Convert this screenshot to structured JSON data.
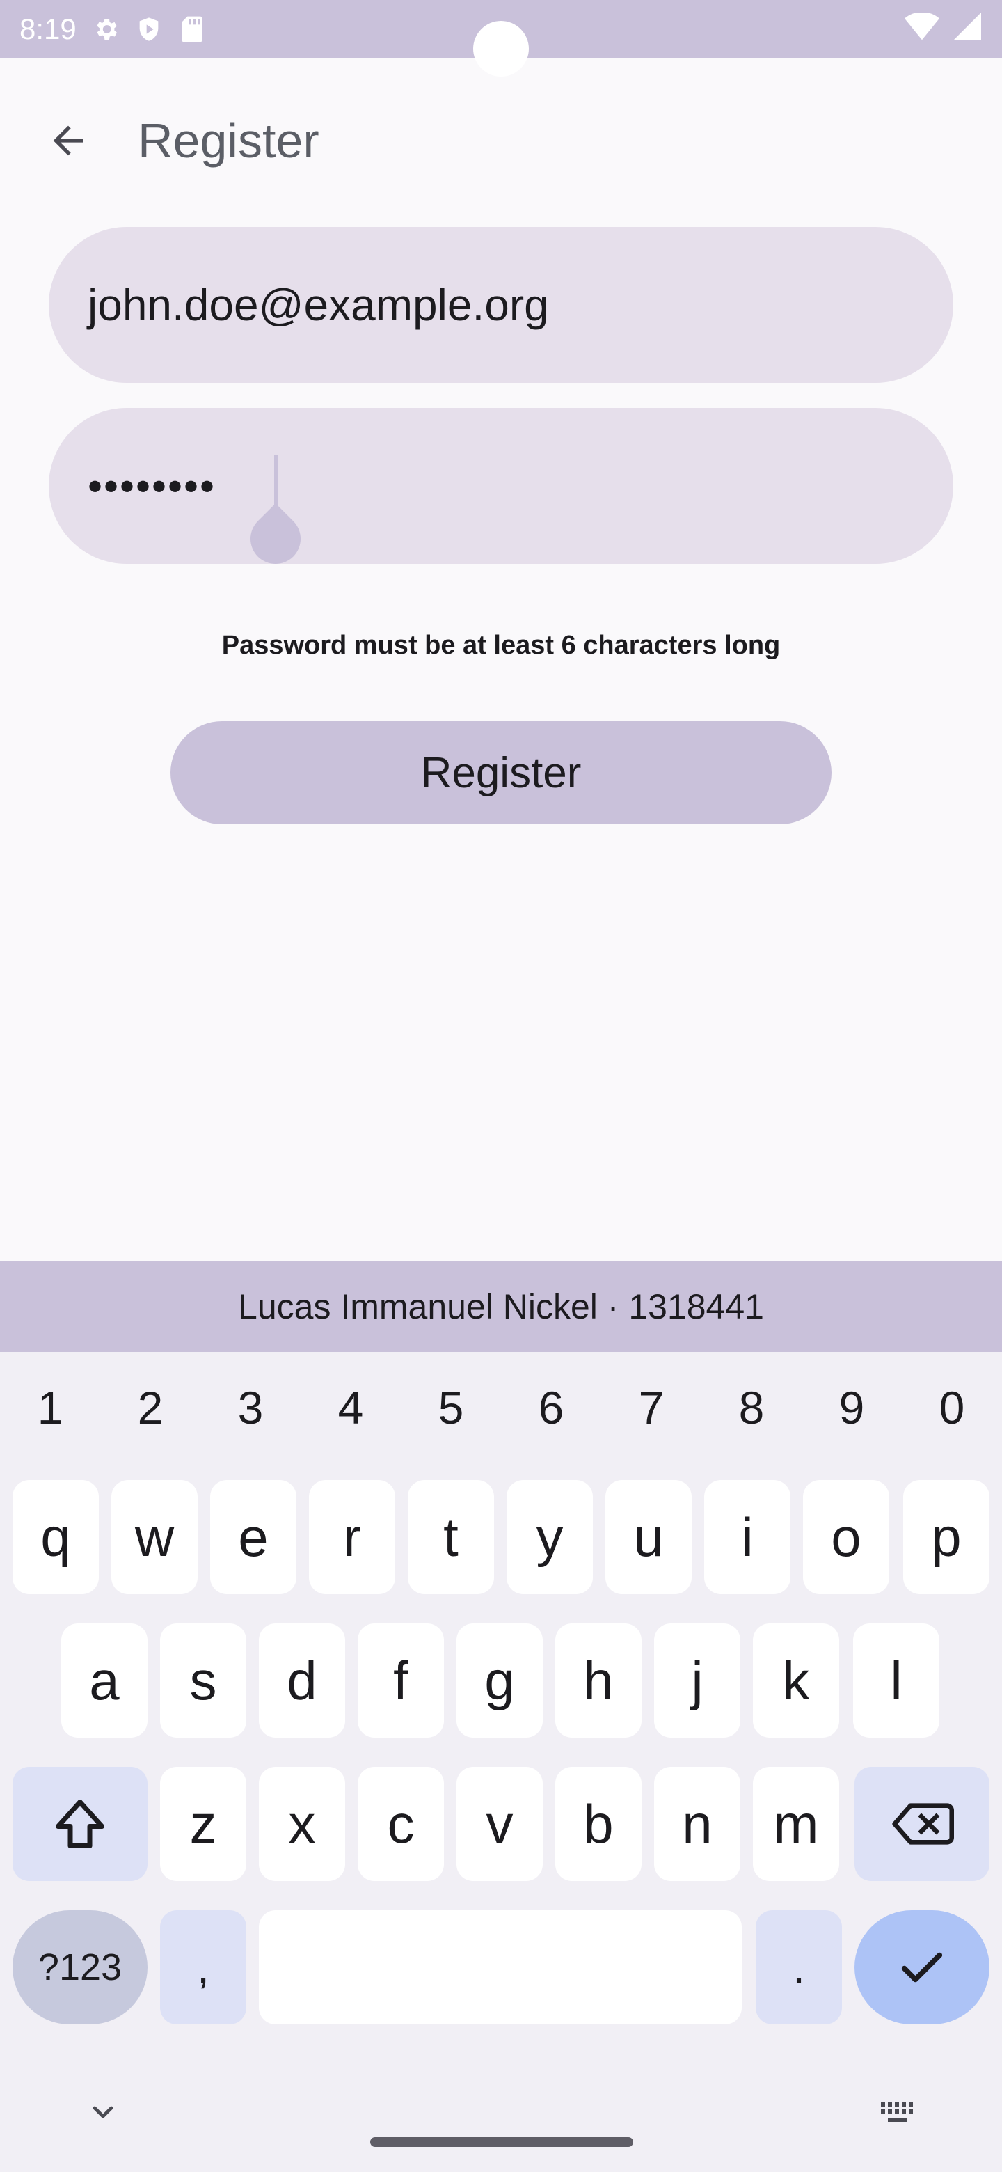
{
  "status_bar": {
    "time": "8:19",
    "icons": [
      "gear-icon",
      "shield-icon",
      "sd-card-icon",
      "wifi-icon",
      "signal-icon"
    ]
  },
  "app_bar": {
    "back_icon": "arrow-back-icon",
    "title": "Register"
  },
  "form": {
    "email_value": "john.doe@example.org",
    "password_masked": "••••••••",
    "helper_text": "Password must be at least 6 characters long",
    "submit_label": "Register"
  },
  "keyboard": {
    "suggestion": "Lucas Immanuel Nickel · 1318441",
    "numbers": [
      "1",
      "2",
      "3",
      "4",
      "5",
      "6",
      "7",
      "8",
      "9",
      "0"
    ],
    "row1": [
      "q",
      "w",
      "e",
      "r",
      "t",
      "y",
      "u",
      "i",
      "o",
      "p"
    ],
    "row2": [
      "a",
      "s",
      "d",
      "f",
      "g",
      "h",
      "j",
      "k",
      "l"
    ],
    "row3": [
      "z",
      "x",
      "c",
      "v",
      "b",
      "n",
      "m"
    ],
    "symbols_label": "?123",
    "comma": ",",
    "period": "."
  },
  "colors": {
    "accent": "#c9c1da",
    "field_bg": "#e6dfeb",
    "enter_key": "#adc3f6"
  }
}
